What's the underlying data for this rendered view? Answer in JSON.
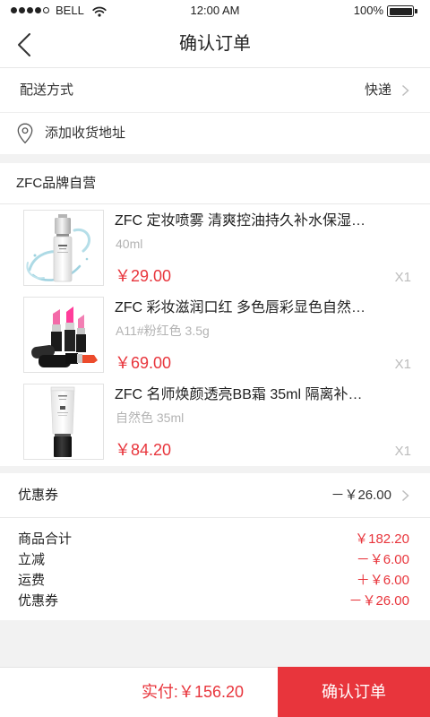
{
  "status_bar": {
    "carrier": "BELL",
    "signal_level": 4,
    "signal_max": 5,
    "time": "12:00 AM",
    "battery_text": "100%",
    "battery_level": 1.0
  },
  "nav": {
    "title": "确认订单"
  },
  "delivery": {
    "label": "配送方式",
    "value": "快递"
  },
  "address": {
    "label": "添加收货地址"
  },
  "store": {
    "name": "ZFC品牌自营"
  },
  "products": [
    {
      "title": "ZFC 定妆喷雾 清爽控油持久补水保湿…",
      "spec": "40ml",
      "price": "￥29.00",
      "qty": "X1"
    },
    {
      "title": "ZFC 彩妆滋润口红 多色唇彩显色自然…",
      "spec": "A11#粉红色 3.5g",
      "price": "￥69.00",
      "qty": "X1"
    },
    {
      "title": "ZFC 名师焕颜透亮BB霜 35ml 隔离补…",
      "spec": "自然色 35ml",
      "price": "￥84.20",
      "qty": "X1"
    }
  ],
  "coupon": {
    "label": "优惠券",
    "value": "－￥26.00"
  },
  "summary": [
    {
      "label": "商品合计",
      "value": "￥182.20"
    },
    {
      "label": "立减",
      "value": "－￥6.00"
    },
    {
      "label": "运费",
      "value": "＋￥6.00"
    },
    {
      "label": "优惠券",
      "value": "－￥26.00"
    }
  ],
  "footer": {
    "total": "实付:￥156.20",
    "confirm_label": "确认订单"
  },
  "icons": {
    "back": "back-arrow-icon",
    "chevron": "chevron-right-icon",
    "location": "location-pin-icon",
    "wifi": "wifi-icon",
    "battery": "battery-icon"
  },
  "colors": {
    "accent": "#e8353c",
    "text": "#222222",
    "muted_text": "#b3b3b3",
    "divider": "#e8e8e8",
    "page_background": "#f2f2f2"
  }
}
